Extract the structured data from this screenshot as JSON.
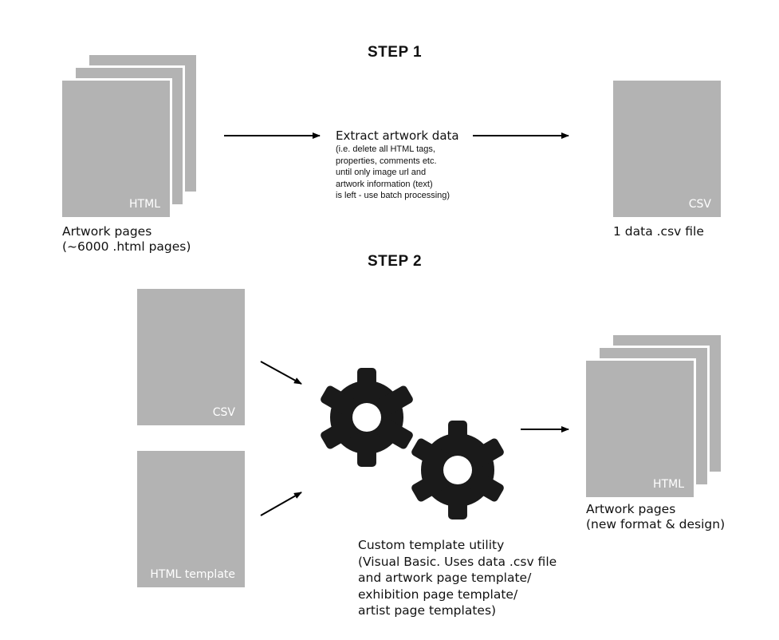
{
  "step1": {
    "heading": "STEP 1",
    "source": {
      "label": "HTML",
      "caption": "Artwork pages\n(~6000 .html pages)"
    },
    "process": {
      "title": "Extract artwork data",
      "details": "(i.e. delete all HTML tags,\nproperties, comments etc.\nuntil only image url and\nartwork information (text)\nis left - use batch processing)"
    },
    "output": {
      "label": "CSV",
      "caption": "1 data .csv file"
    }
  },
  "step2": {
    "heading": "STEP 2",
    "inputs": [
      {
        "label": "CSV"
      },
      {
        "label": "HTML template"
      }
    ],
    "utility": {
      "caption": "Custom template utility\n(Visual Basic. Uses data .csv file\nand artwork page template/\nexhibition page template/\nartist page templates)"
    },
    "output": {
      "label": "HTML",
      "caption": "Artwork pages\n(new format & design)"
    }
  },
  "colors": {
    "page": "#b3b3b3",
    "gear": "#1a1a1a",
    "arrow": "#000000"
  },
  "icons": [
    "gear-icon",
    "gear-icon"
  ]
}
